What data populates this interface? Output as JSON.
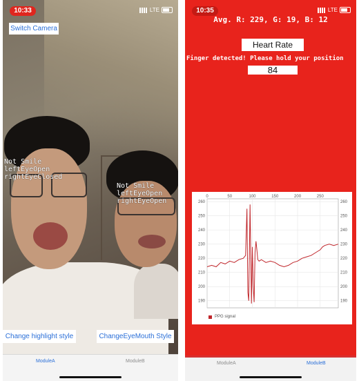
{
  "left_screen": {
    "status": {
      "time": "10:33",
      "network": "LTE"
    },
    "switch_camera_label": "Switch Camera",
    "face1_lines": "Not Smile\nleftEyeOpen\nrightEyeClosed",
    "face2_lines": "Not Smile\nleftEyeOpen\nrightEyeOpen",
    "change_highlight_label": "Change highlight style",
    "change_eye_mouth_label": "ChangeEyeMouth Style",
    "tabs": [
      {
        "label": "ModuleA",
        "active": true
      },
      {
        "label": "ModuleB",
        "active": false
      }
    ]
  },
  "right_screen": {
    "status": {
      "time": "10:35",
      "network": "LTE"
    },
    "avg_rgb": "Avg. R: 229, G: 19, B: 12",
    "heart_rate_title": "Heart Rate",
    "message": "Finger detected! Please hold your position",
    "bpm": "84",
    "tabs": [
      {
        "label": "ModuleA",
        "active": false
      },
      {
        "label": "ModuleB",
        "active": true
      }
    ],
    "colors": {
      "background": "#e8231c",
      "series": "#c0262b"
    }
  },
  "chart_data": {
    "type": "line",
    "x_ticks": [
      0,
      50,
      100,
      150,
      200,
      250
    ],
    "y_ticks": [
      190,
      200,
      210,
      220,
      230,
      240,
      250,
      260
    ],
    "xlim": [
      0,
      290
    ],
    "ylim": [
      185,
      262
    ],
    "legend": "bottom-left",
    "series": [
      {
        "name": "PPG signal",
        "x": [
          0,
          10,
          20,
          30,
          40,
          50,
          60,
          70,
          80,
          85,
          88,
          90,
          92,
          95,
          98,
          100,
          102,
          104,
          106,
          108,
          110,
          112,
          115,
          120,
          130,
          140,
          150,
          160,
          170,
          180,
          190,
          200,
          210,
          220,
          230,
          240,
          250,
          255,
          260,
          270,
          280,
          290
        ],
        "y": [
          214,
          215,
          214,
          217,
          216,
          218,
          217,
          219,
          220,
          222,
          255,
          196,
          190,
          258,
          188,
          228,
          200,
          189,
          224,
          232,
          226,
          219,
          218,
          219,
          217,
          218,
          217,
          215,
          214,
          215,
          217,
          218,
          220,
          221,
          222,
          224,
          226,
          228,
          229,
          230,
          229,
          230
        ]
      }
    ]
  }
}
